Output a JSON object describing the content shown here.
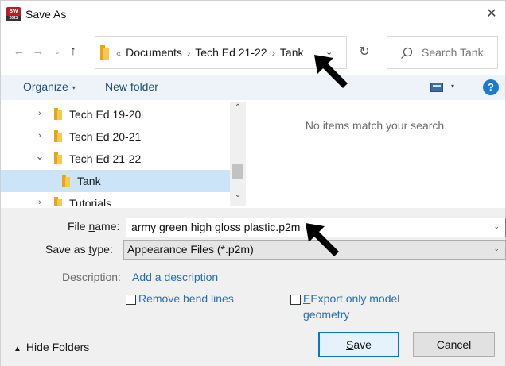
{
  "window": {
    "title": "Save As",
    "app_icon_text": "SW",
    "app_icon_year": "2021",
    "close_glyph": "✕"
  },
  "navigation": {
    "back_icon": "arrow-left-icon",
    "forward_icon": "arrow-right-icon",
    "recent_icon": "chevron-down-icon",
    "up_icon": "arrow-up-icon",
    "address": {
      "overflow_glyph": "«",
      "crumbs": [
        "Documents",
        "Tech Ed 21-22",
        "Tank"
      ],
      "separator": "›"
    },
    "refresh_icon": "refresh-icon",
    "search_placeholder": "Search Tank"
  },
  "toolbar": {
    "organize_label": "Organize",
    "new_folder_label": "New folder",
    "help_label": "?"
  },
  "tree": {
    "items": [
      {
        "label": "Tech Ed 19-20",
        "chevron": "›",
        "expanded": false,
        "selected": false
      },
      {
        "label": "Tech Ed 20-21",
        "chevron": "›",
        "expanded": false,
        "selected": false
      },
      {
        "label": "Tech Ed 21-22",
        "chevron": "⌄",
        "expanded": true,
        "selected": false
      },
      {
        "label": "Tank",
        "chevron": "",
        "expanded": false,
        "selected": true
      },
      {
        "label": "Tutorials",
        "chevron": "›",
        "expanded": false,
        "selected": false
      }
    ]
  },
  "content": {
    "empty_message": "No items match your search."
  },
  "form": {
    "file_name_label_pre": "File ",
    "file_name_label_key": "n",
    "file_name_label_post": "ame:",
    "file_name_value": "army green high gloss plastic.p2m",
    "save_type_label_pre": "Save as ",
    "save_type_label_key": "t",
    "save_type_label_post": "ype:",
    "save_type_value": "Appearance Files (*.p2m)",
    "description_label": "Description:",
    "description_link": "Add a description",
    "remove_bend_lines_label": "Remove bend lines",
    "export_geometry_label_line1": "Export only model",
    "export_geometry_label_line2": "geometry",
    "export_geometry_key": "E",
    "remove_bend_lines_checked": false,
    "export_geometry_checked": false
  },
  "footer": {
    "hide_folders_label": "Hide Folders",
    "save_button_key": "S",
    "save_button_rest": "ave",
    "cancel_button_label": "Cancel"
  },
  "colors": {
    "accent": "#0078d7",
    "link": "#1f6fbf",
    "selection": "#cce4f7",
    "folder": "#f5c94b"
  }
}
